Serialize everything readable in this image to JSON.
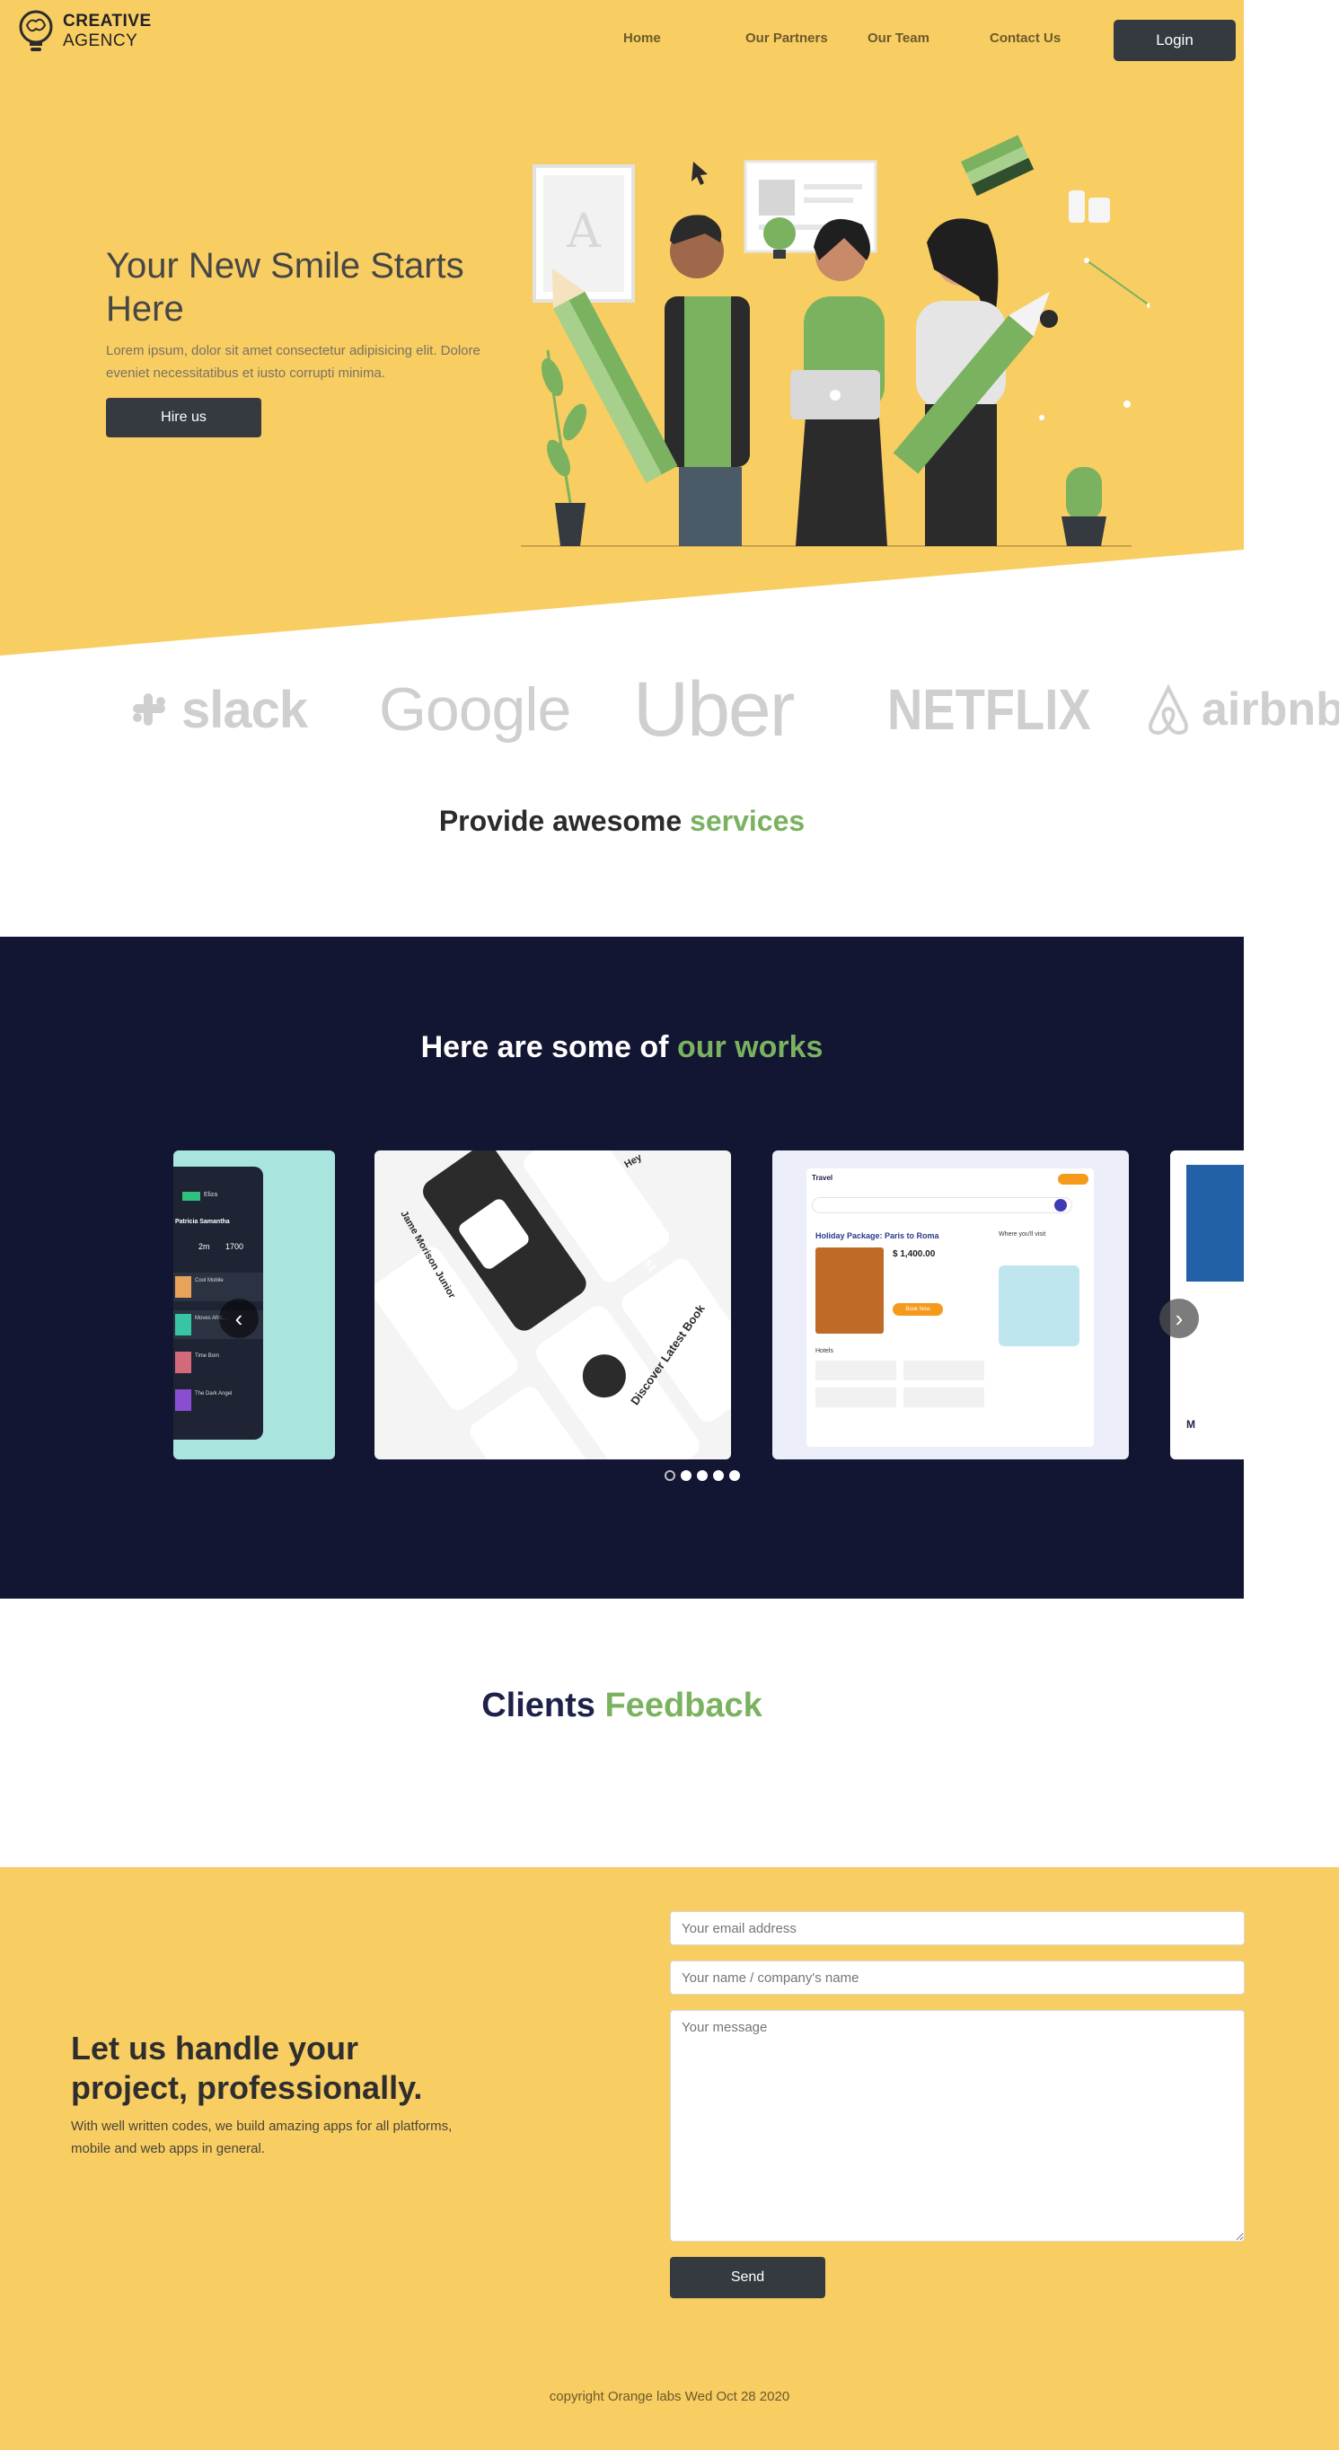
{
  "brand": {
    "line1": "CREATIVE",
    "line2": "AGENCY"
  },
  "nav": {
    "items": [
      {
        "label": "Home"
      },
      {
        "label": "Our Partners"
      },
      {
        "label": "Our Team"
      },
      {
        "label": "Contact Us"
      }
    ],
    "login_label": "Login"
  },
  "hero": {
    "title": "Your New Smile Starts Here",
    "description": "Lorem ipsum, dolor sit amet consectetur adipisicing elit. Dolore eveniet necessitatibus et iusto corrupti minima.",
    "cta_label": "Hire us"
  },
  "partners": [
    "slack",
    "Google",
    "Uber",
    "NETFLIX",
    "airbnb"
  ],
  "services": {
    "title_prefix": "Provide awesome ",
    "title_accent": "services"
  },
  "works": {
    "title_prefix": "Here are some of ",
    "title_accent": "our works",
    "cards": [
      {
        "name": "music-app-preview",
        "lines": [
          "Eliza",
          "Patricia Samantha",
          "2m",
          "1700",
          "Cool Mobile",
          "Moves Afric...",
          "Time Bom",
          "The Dark Angel"
        ]
      },
      {
        "name": "book-app-preview",
        "lines": [
          "Discover Latest Book",
          "Discover Latest Book",
          "Jame Morison Junior",
          "Hey"
        ]
      },
      {
        "name": "travel-app-preview",
        "lines": [
          "Travel",
          "Holiday Package: Paris to Roma",
          "$ 1,400.00",
          "Book Now",
          "Where you'll visit",
          "Hotels"
        ]
      },
      {
        "name": "partial-preview",
        "lines": [
          "M"
        ]
      }
    ],
    "pagination": {
      "count": 5,
      "active": 0
    }
  },
  "feedback": {
    "title_prefix": "Clients ",
    "title_accent": "Feedback"
  },
  "contact": {
    "title": "Let us handle your project, professionally.",
    "description": "With well written codes, we build amazing apps for all platforms, mobile and web apps in general.",
    "email_placeholder": "Your email address",
    "name_placeholder": "Your name / company's name",
    "message_placeholder": "Your message",
    "send_label": "Send"
  },
  "footer": {
    "copyright": "copyright Orange labs Wed Oct 28 2020"
  },
  "colors": {
    "hero_yellow": "#f8cd62",
    "accent_green": "#7ab260",
    "dark_navy": "#131632",
    "button_dark": "#343a40"
  }
}
